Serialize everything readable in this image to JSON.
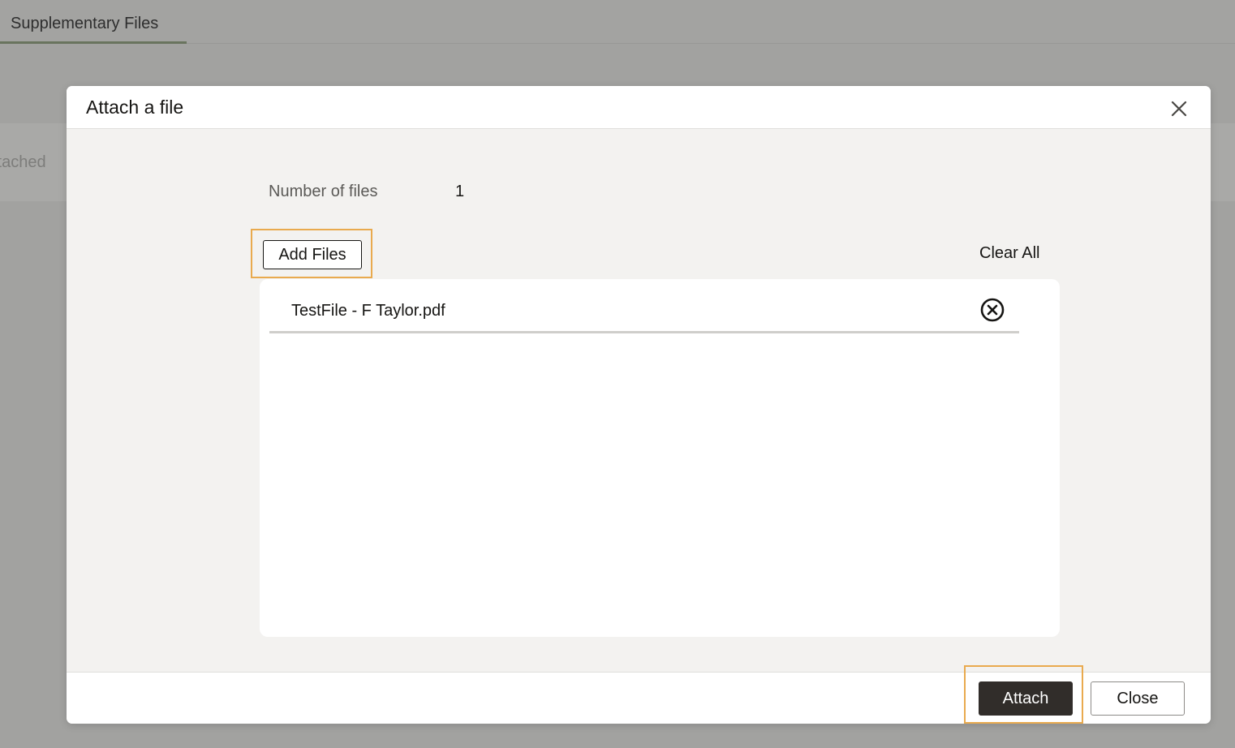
{
  "background": {
    "tab_label": "Supplementary Files",
    "band_text": "ttached"
  },
  "dialog": {
    "title": "Attach a file",
    "close_icon": "close-icon",
    "file_count_label": "Number of files",
    "file_count_value": "1",
    "add_files_label": "Add Files",
    "clear_all_label": "Clear All",
    "files": [
      {
        "name": "TestFile - F Taylor.pdf",
        "remove_icon": "remove-circle-icon"
      }
    ],
    "attach_label": "Attach",
    "close_label": "Close"
  },
  "colors": {
    "overlay": "#a2a2a0",
    "primary_button": "#312d2a",
    "highlight": "#e9aa4e",
    "tab_underline": "#69745e"
  }
}
